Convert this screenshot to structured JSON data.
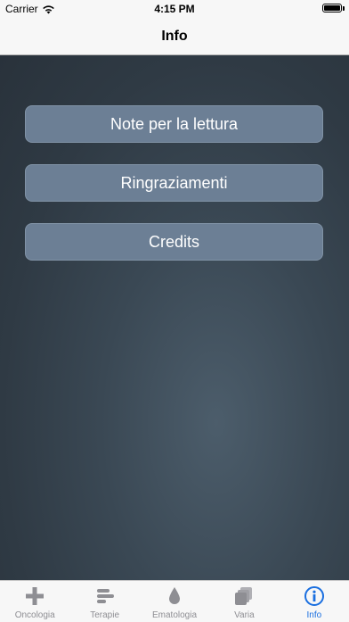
{
  "status_bar": {
    "carrier": "Carrier",
    "time": "4:15 PM",
    "wifi_icon": "wifi-icon",
    "battery_icon": "battery-icon"
  },
  "nav": {
    "title": "Info"
  },
  "menu": {
    "items": [
      {
        "label": "Note per la lettura"
      },
      {
        "label": "Ringraziamenti"
      },
      {
        "label": "Credits"
      }
    ]
  },
  "tabs": [
    {
      "label": "Oncologia",
      "icon": "plus-icon",
      "active": false
    },
    {
      "label": "Terapie",
      "icon": "bars-icon",
      "active": false
    },
    {
      "label": "Ematologia",
      "icon": "drop-icon",
      "active": false
    },
    {
      "label": "Varia",
      "icon": "stack-icon",
      "active": false
    },
    {
      "label": "Info",
      "icon": "info-icon",
      "active": true
    }
  ],
  "colors": {
    "accent": "#1a6fe0",
    "button": "#6c7f95",
    "inactive": "#8e8e93"
  }
}
